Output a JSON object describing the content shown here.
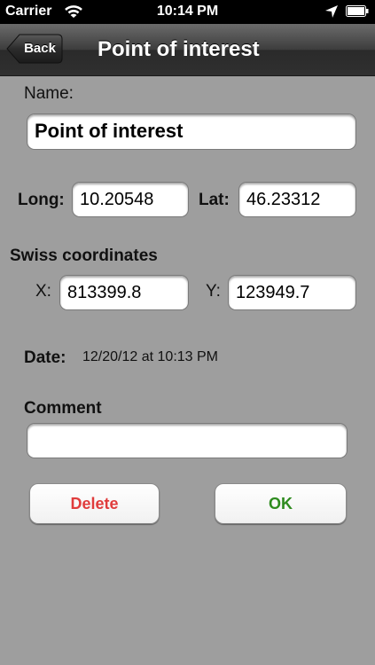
{
  "status_bar": {
    "carrier": "Carrier",
    "time": "10:14 PM"
  },
  "nav": {
    "back_label": "Back",
    "title": "Point of interest"
  },
  "form": {
    "name_label": "Name:",
    "name_value": "Point of interest",
    "long_label": "Long:",
    "long_value": "10.20548",
    "lat_label": "Lat:",
    "lat_value": "46.23312",
    "swiss_heading": "Swiss coordinates",
    "x_label": "X:",
    "x_value": "813399.8",
    "y_label": "Y:",
    "y_value": "123949.7",
    "date_label": "Date:",
    "date_value": "12/20/12 at 10:13 PM",
    "comment_label": "Comment",
    "comment_value": ""
  },
  "actions": {
    "delete_label": "Delete",
    "ok_label": "OK"
  },
  "colors": {
    "delete": "#e03c3c",
    "ok": "#2e8b1e",
    "background": "#9e9e9e"
  }
}
